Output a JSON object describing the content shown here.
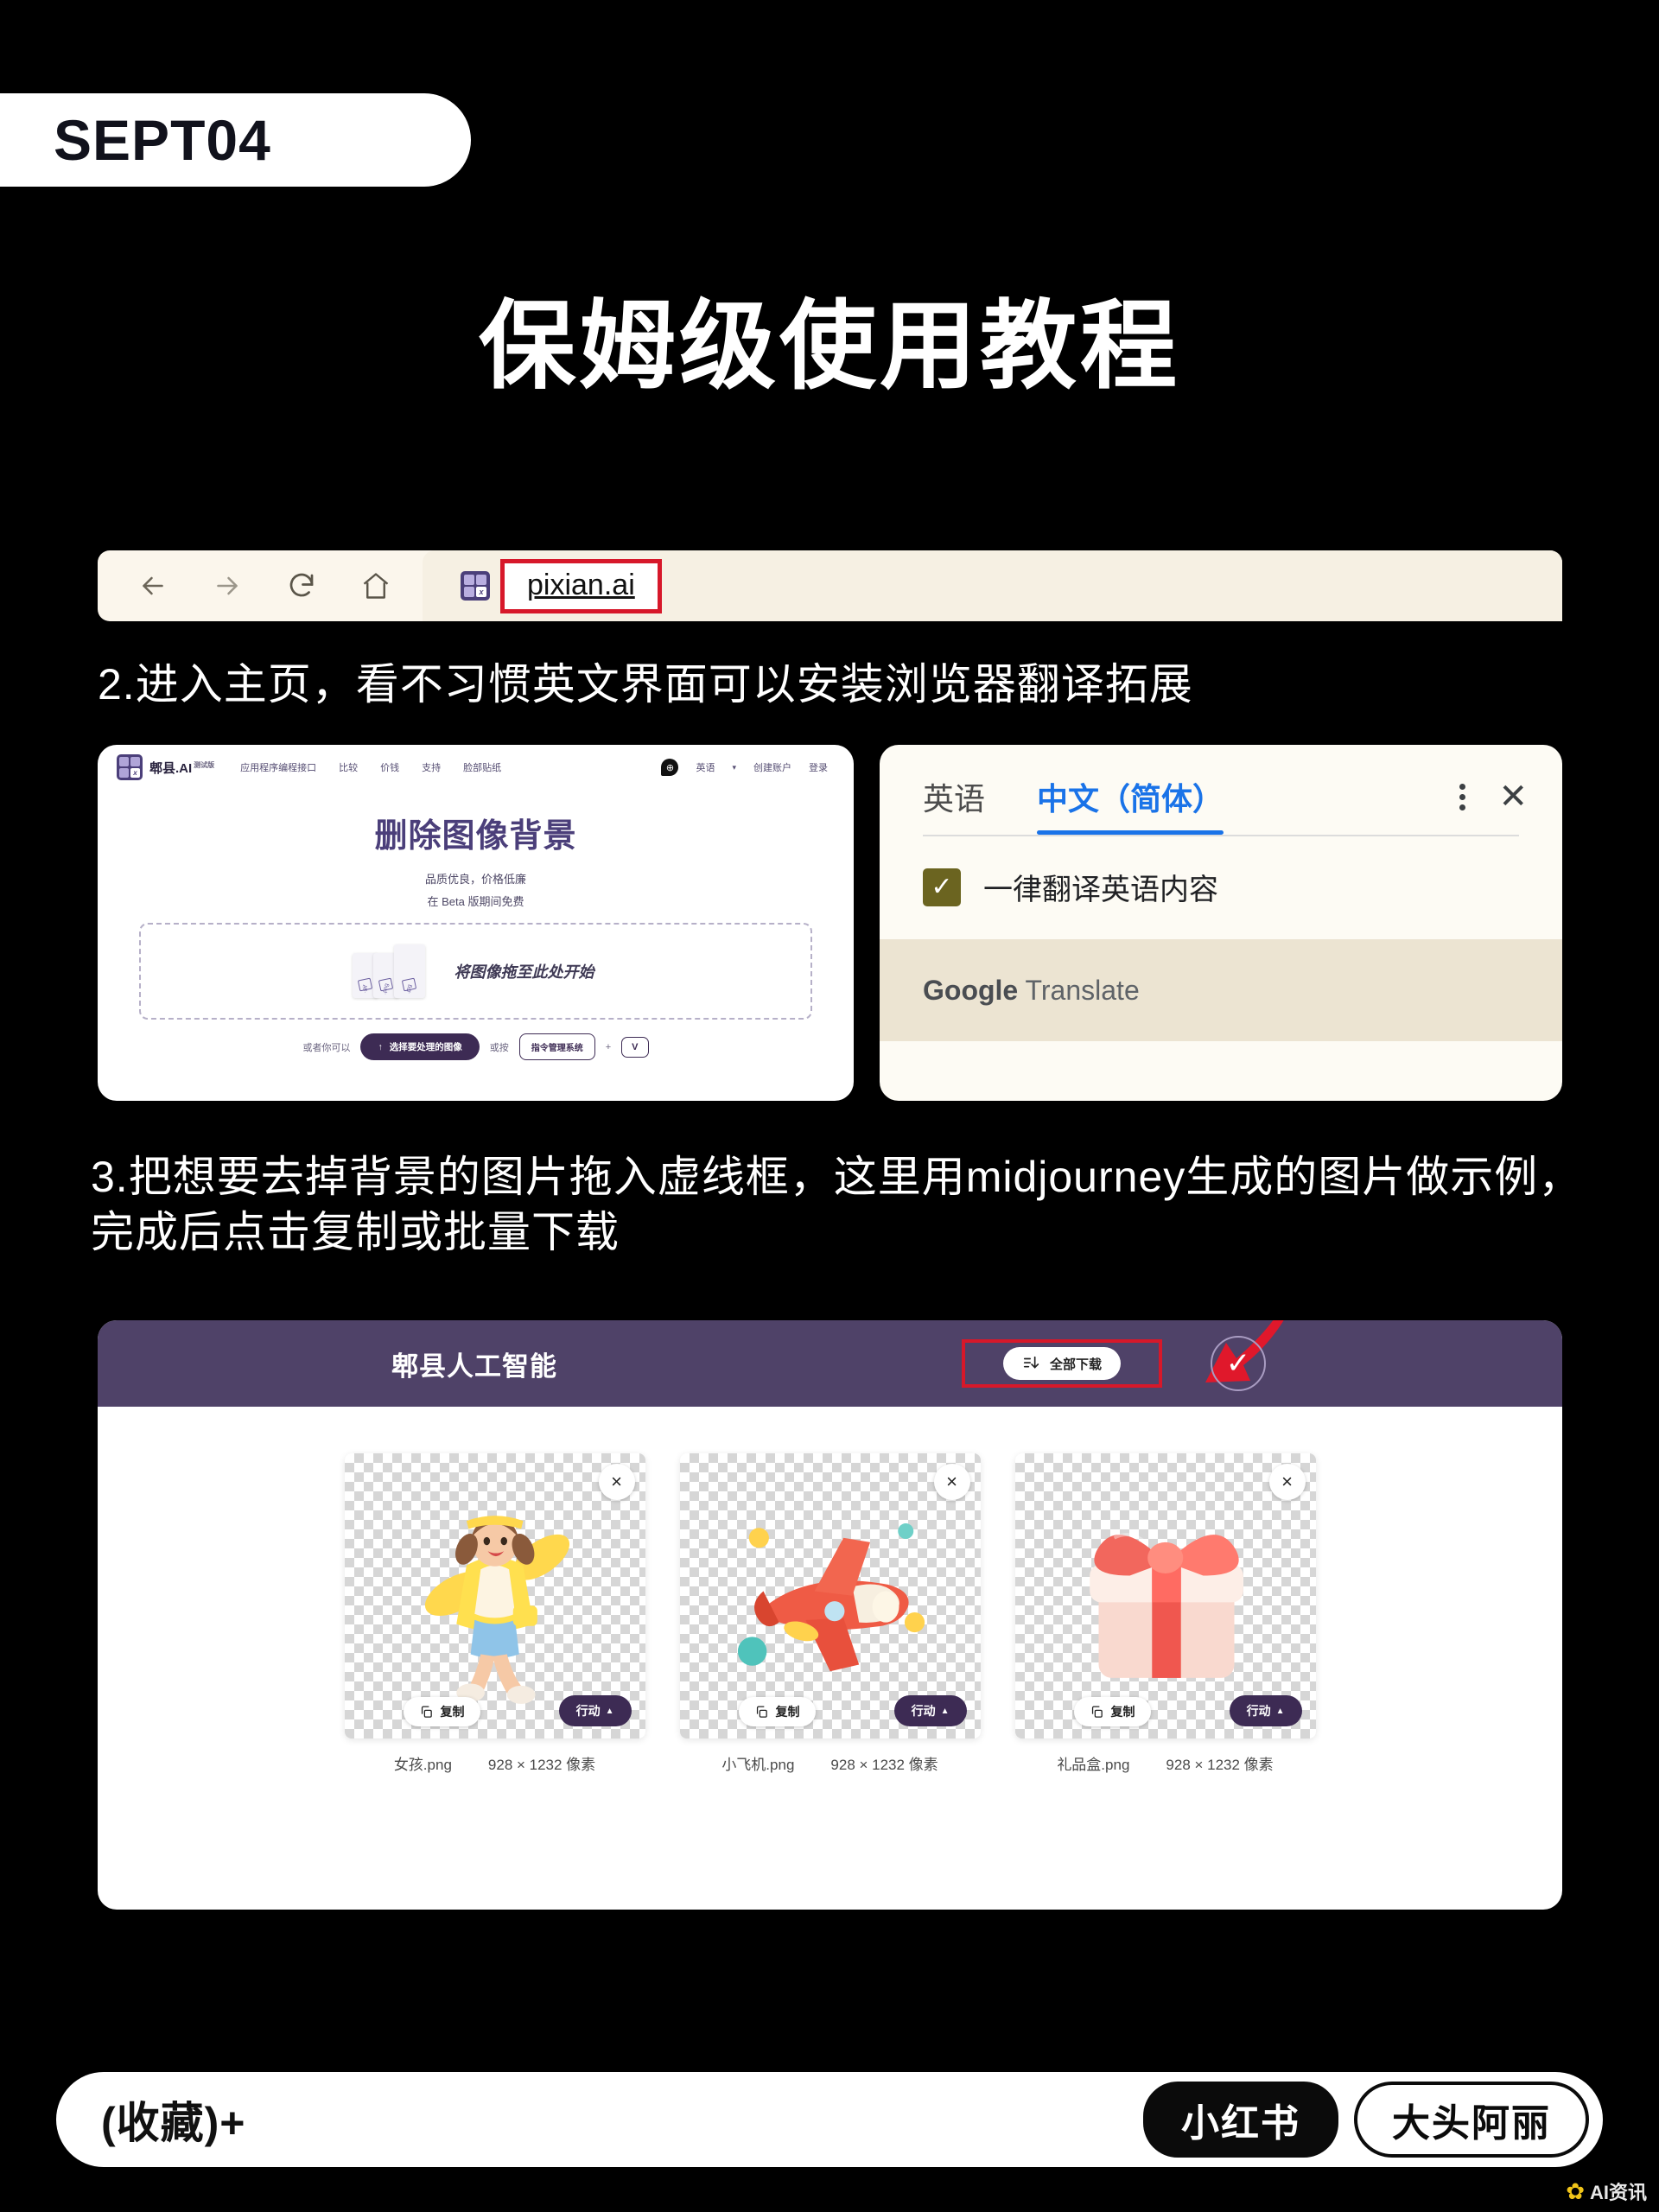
{
  "badge": {
    "date": "SEPT04"
  },
  "title": "保姆级使用教程",
  "browser": {
    "back_icon": "back-arrow-icon",
    "forward_icon": "forward-arrow-icon",
    "reload_icon": "reload-icon",
    "home_icon": "home-icon",
    "favicon_label": "x",
    "url": "pixian.ai",
    "highlight_color": "#d7182a"
  },
  "steps": {
    "step2": "2.进入主页，看不习惯英文界面可以安装浏览器翻译拓展",
    "step3": "3.把想要去掉背景的图片拖入虚线框，这里用midjourney生成的图片做示例，完成后点击复制或批量下载"
  },
  "site": {
    "logo_text": "郫县.AI",
    "logo_sup": "测试版",
    "menu": [
      "应用程序编程接口",
      "比较",
      "价钱",
      "支持",
      "脸部贴纸"
    ],
    "language": "英语",
    "language_caret": "▾",
    "signup": "创建账户",
    "login": "登录",
    "heading": "删除图像背景",
    "sub1": "品质优良，价格低廉",
    "sub2": "在 Beta 版期间免费",
    "dropzone_text": "将图像拖至此处开始",
    "file_exts": [
      ".gif",
      ".png",
      ".jpg"
    ],
    "or_you_can": "或者你可以",
    "select_button": "选择要处理的图像",
    "or_press": "或按",
    "cmd_key": "指令管理系统",
    "plus": "+",
    "v_key": "V"
  },
  "translate": {
    "tab_source": "英语",
    "tab_target": "中文（简体）",
    "active_tab_color": "#1a73e8",
    "menu_icon": "kebab-menu-icon",
    "close_icon": "close-icon",
    "checkbox_checked": true,
    "checkbox_label": "一律翻译英语内容",
    "brand_g": "Google",
    "brand_t": "Translate"
  },
  "result": {
    "app_title": "郫县人工智能",
    "download_all": "全部下载",
    "download_icon": "download-list-icon",
    "confirm_icon": "check-icon",
    "header_color": "#4f4268",
    "cards": [
      {
        "name": "女孩.png",
        "size": "928 × 1232 像素",
        "copy": "复制",
        "action": "行动",
        "close": "×",
        "art": "girl"
      },
      {
        "name": "小飞机.png",
        "size": "928 × 1232 像素",
        "copy": "复制",
        "action": "行动",
        "close": "×",
        "art": "plane"
      },
      {
        "name": "礼品盒.png",
        "size": "928 × 1232 像素",
        "copy": "复制",
        "action": "行动",
        "close": "×",
        "art": "gift"
      }
    ]
  },
  "footer": {
    "favorite": "(收藏)+",
    "platform": "小红书",
    "author": "大头阿丽",
    "watermark": "AI资讯"
  }
}
